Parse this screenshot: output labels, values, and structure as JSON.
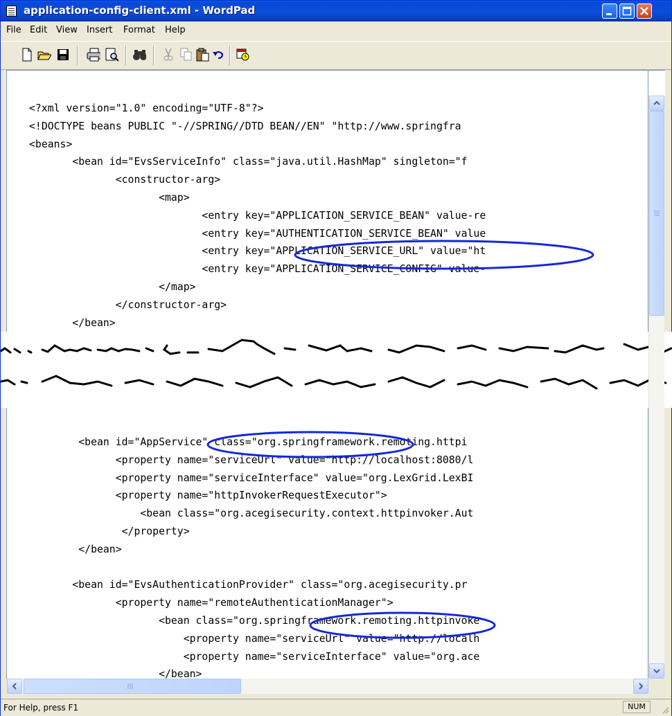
{
  "window": {
    "title": "application-config-client.xml - WordPad",
    "accent": "#0a48d8"
  },
  "menu": {
    "items": [
      "File",
      "Edit",
      "View",
      "Insert",
      "Format",
      "Help"
    ]
  },
  "toolbar": {
    "icons": [
      "new-icon",
      "open-icon",
      "save-icon",
      "print-icon",
      "print-preview-icon",
      "find-icon",
      "cut-icon",
      "copy-icon",
      "paste-icon",
      "undo-icon",
      "insert-datetime-icon"
    ]
  },
  "document": {
    "lines_top": [
      "<?xml version=\"1.0\" encoding=\"UTF-8\"?>",
      "<!DOCTYPE beans PUBLIC \"-//SPRING//DTD BEAN//EN\" \"http://www.springfra",
      "<beans>",
      "       <bean id=\"EvsServiceInfo\" class=\"java.util.HashMap\" singleton=\"f",
      "              <constructor-arg>",
      "                     <map>",
      "                            <entry key=\"APPLICATION_SERVICE_BEAN\" value-re",
      "                            <entry key=\"AUTHENTICATION_SERVICE_BEAN\" value",
      "                            <entry key=\"APPLICATION_SERVICE_URL\" value=\"ht",
      "                            <entry key=\"APPLICATION_SERVICE_CONFIG\" value-",
      "                     </map>",
      "              </constructor-arg>",
      "       </bean>"
    ],
    "lines_bottom": [
      "        <bean id=\"AppService\" class=\"org.springframework.remoting.httpi",
      "              <property name=\"serviceUrl\" value=\"http://localhost:8080/l",
      "              <property name=\"serviceInterface\" value=\"org.LexGrid.LexBI",
      "              <property name=\"httpInvokerRequestExecutor\">",
      "                  <bean class=\"org.acegisecurity.context.httpinvoker.Aut",
      "               </property>",
      "        </bean>",
      "",
      "       <bean id=\"EvsAuthenticationProvider\" class=\"org.acegisecurity.pr",
      "              <property name=\"remoteAuthenticationManager\">",
      "                     <bean class=\"org.springframework.remoting.httpinvoke",
      "                         <property name=\"serviceUrl\" value=\"http://localh",
      "                         <property name=\"serviceInterface\" value=\"org.ace",
      "                     </bean>",
      "               </property>"
    ],
    "highlight_color": "#1727d6"
  },
  "status": {
    "help_text": "For Help, press F1",
    "num_indicator": "NUM"
  }
}
